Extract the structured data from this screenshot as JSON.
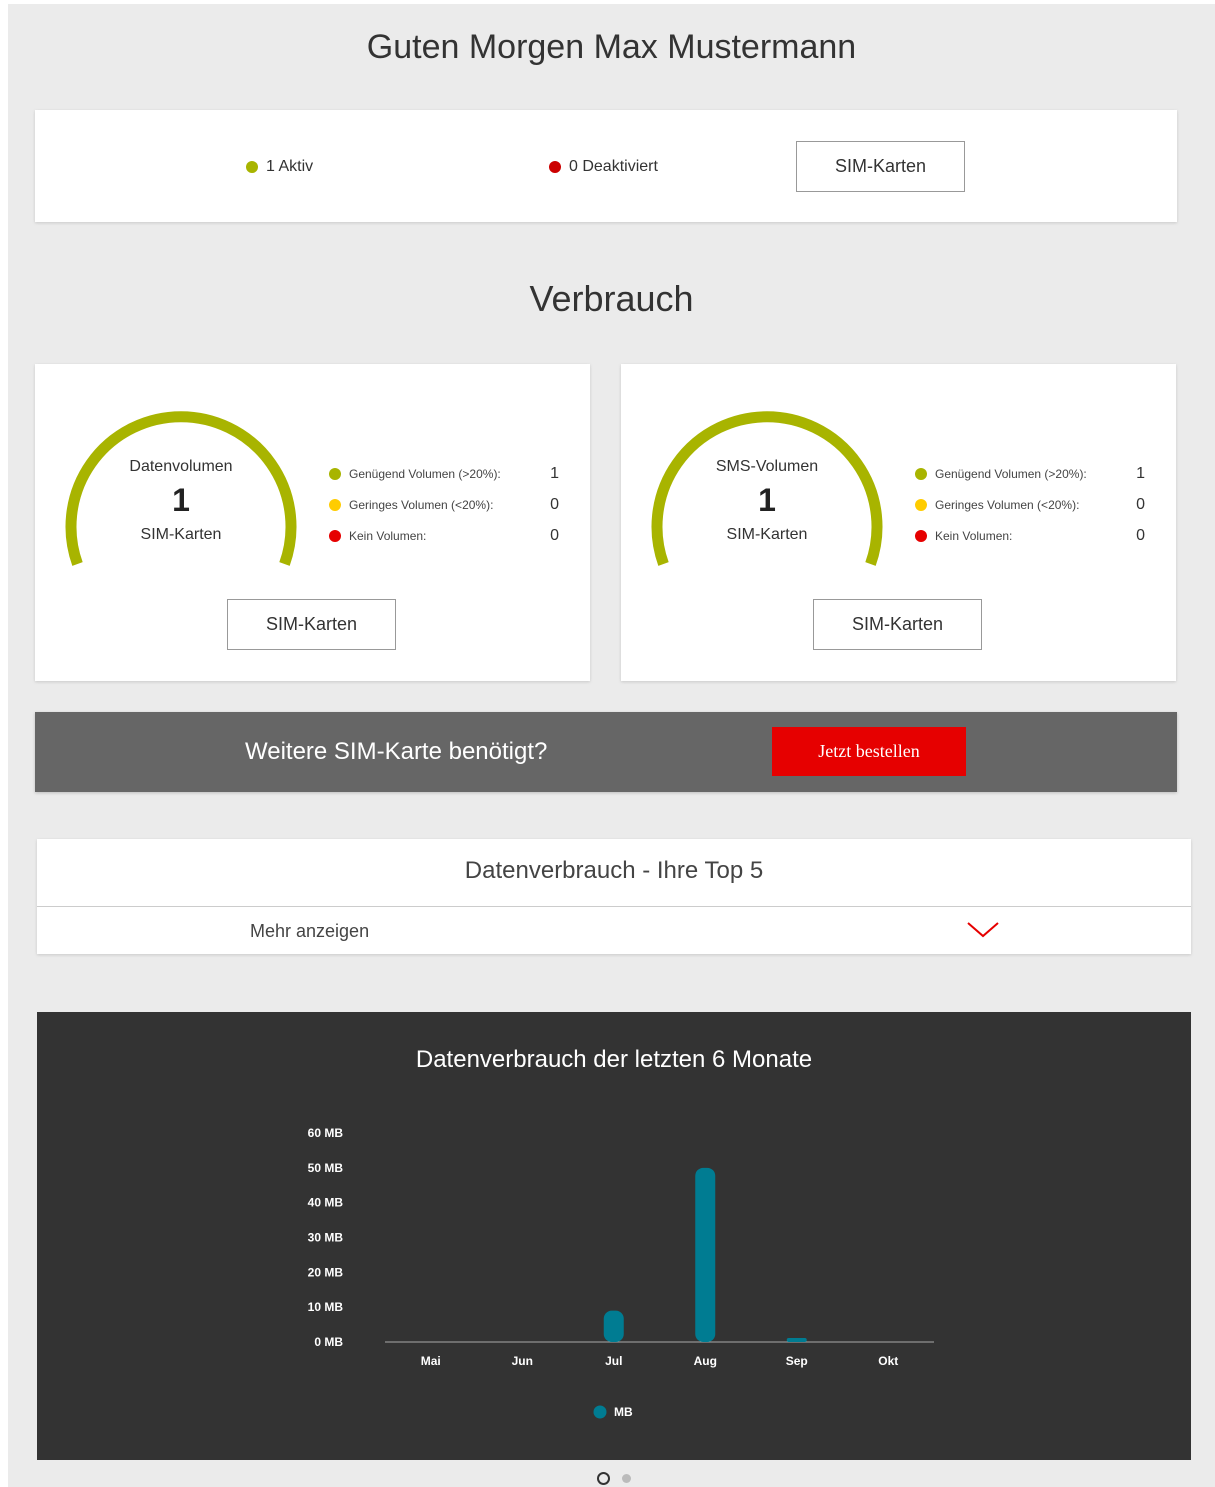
{
  "greeting": "Guten Morgen Max Mustermann",
  "status": {
    "active_label": "1 Aktiv",
    "deactivated_label": "0 Deaktiviert",
    "button_label": "SIM-Karten",
    "active_color": "#a8b400",
    "deactivated_color": "#cc0000"
  },
  "usage": {
    "title": "Verbrauch",
    "cards": [
      {
        "gauge_label": "Datenvolumen",
        "count": "1",
        "unit": "SIM-Karten",
        "legend": [
          {
            "label": "Genügend Volumen (>20%):",
            "value": "1",
            "color": "#a8b400"
          },
          {
            "label": "Geringes Volumen (<20%):",
            "value": "0",
            "color": "#ffcc00"
          },
          {
            "label": "Kein Volumen:",
            "value": "0",
            "color": "#e60000"
          }
        ],
        "button_label": "SIM-Karten"
      },
      {
        "gauge_label": "SMS-Volumen",
        "count": "1",
        "unit": "SIM-Karten",
        "legend": [
          {
            "label": "Genügend Volumen (>20%):",
            "value": "1",
            "color": "#a8b400"
          },
          {
            "label": "Geringes Volumen (<20%):",
            "value": "0",
            "color": "#ffcc00"
          },
          {
            "label": "Kein Volumen:",
            "value": "0",
            "color": "#e60000"
          }
        ],
        "button_label": "SIM-Karten"
      }
    ],
    "gauge_color": "#a8b400"
  },
  "promo": {
    "text": "Weitere SIM-Karte benötigt?",
    "button_label": "Jetzt bestellen",
    "button_color": "#e60000"
  },
  "top5": {
    "title": "Datenverbrauch - Ihre Top 5",
    "more_label": "Mehr anzeigen",
    "chevron_icon": "chevron-down-icon"
  },
  "chart_data": {
    "type": "bar",
    "title": "Datenverbrauch der letzten 6 Monate",
    "categories": [
      "Mai",
      "Jun",
      "Jul",
      "Aug",
      "Sep",
      "Okt"
    ],
    "series": [
      {
        "name": "MB",
        "values": [
          0,
          0,
          9,
          50,
          1,
          0
        ],
        "color": "#007c92"
      }
    ],
    "ylim": [
      0,
      60
    ],
    "yticks": [
      0,
      10,
      20,
      30,
      40,
      50,
      60
    ],
    "ytick_labels": [
      "0 MB",
      "10 MB",
      "20 MB",
      "30 MB",
      "40 MB",
      "50 MB",
      "60 MB"
    ],
    "legend": "bottom-center",
    "grid": false
  },
  "pager": {
    "pages": 2,
    "active": 0
  }
}
